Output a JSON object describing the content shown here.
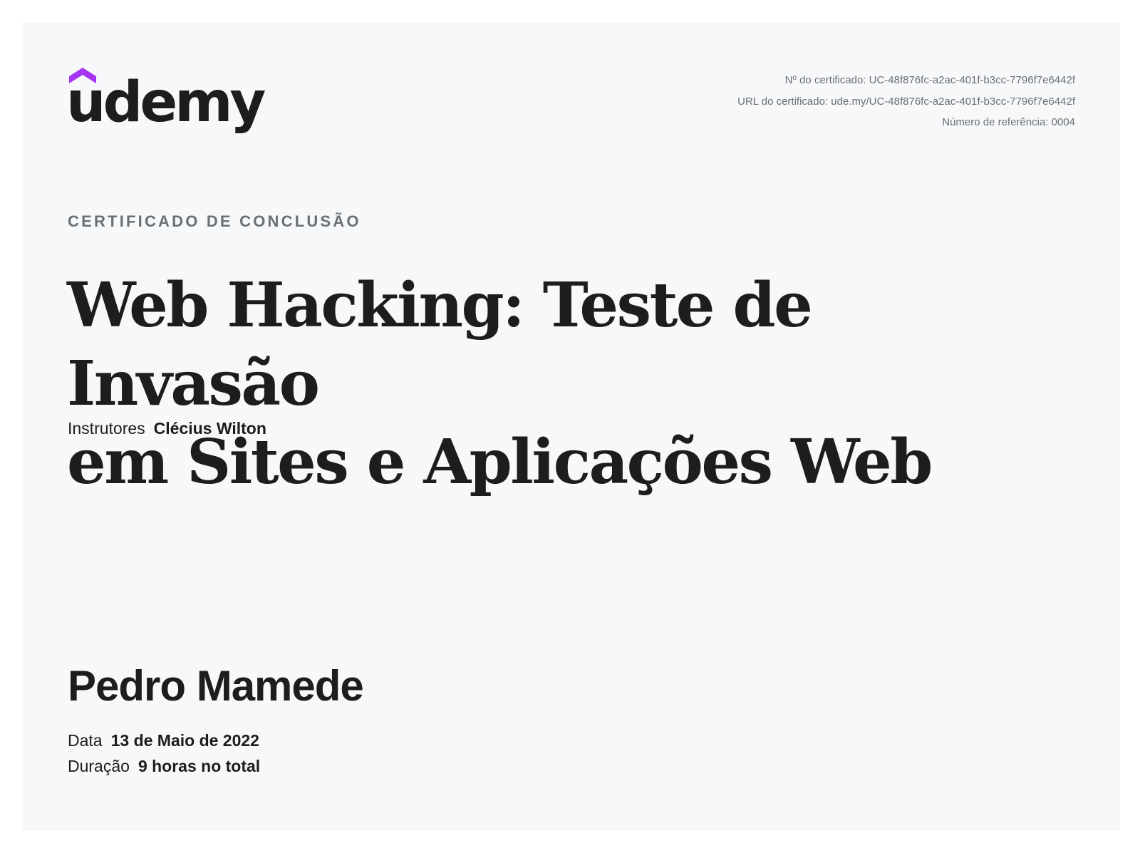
{
  "brand": {
    "name": "udemy",
    "accent_color": "#a435f0",
    "text_color": "#1c1d1f"
  },
  "meta": {
    "certificate_number": "Nº do certificado: UC-48f876fc-a2ac-401f-b3cc-7796f7e6442f",
    "certificate_url": "URL do certificado: ude.my/UC-48f876fc-a2ac-401f-b3cc-7796f7e6442f",
    "reference_number": "Número de referência: 0004"
  },
  "certificate": {
    "eyebrow": "CERTIFICADO DE CONCLUSÃO",
    "course_title_line1": "Web Hacking: Teste de Invasão",
    "course_title_line2": "em Sites e Aplicações Web",
    "instructors_label": "Instrutores",
    "instructors_value": "Clécius Wilton",
    "recipient_name": "Pedro Mamede",
    "date_label": "Data",
    "date_value": "13 de Maio de 2022",
    "duration_label": "Duração",
    "duration_value": "9 horas no total"
  },
  "icons": {
    "logo": "udemy-logo-icon"
  }
}
